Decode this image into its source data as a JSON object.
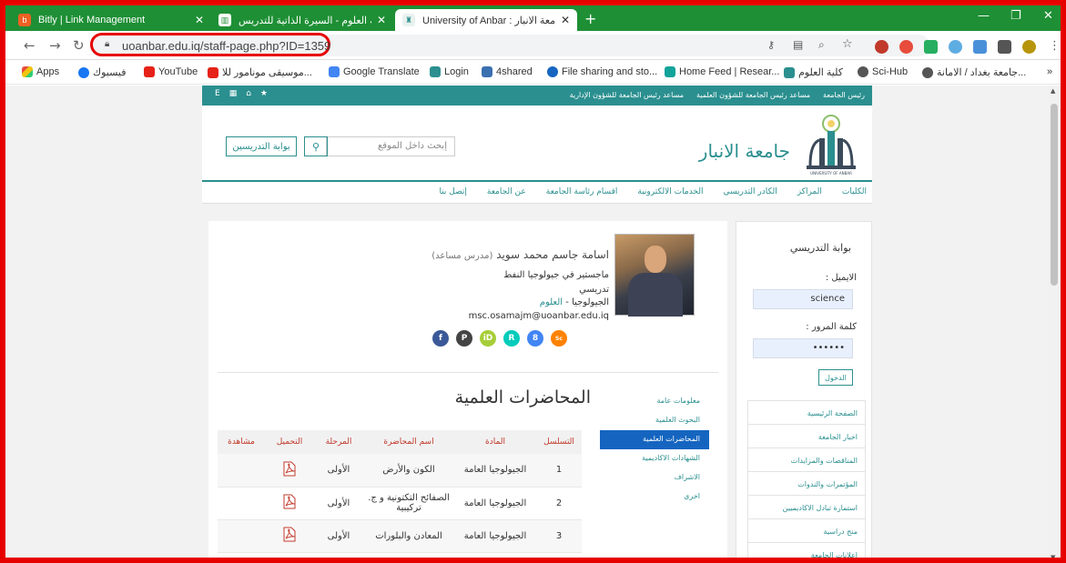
{
  "browser": {
    "tabs": [
      {
        "title": "Bitly | Link Management",
        "active": false
      },
      {
        "title": "كلية العلوم - السيرة الذاتية للتدريس...",
        "active": false
      },
      {
        "title": "University of Anbar : جامعة الانبار",
        "active": true
      }
    ],
    "new_tab": "+",
    "url": "uoanbar.edu.iq/staff-page.php?ID=1359",
    "bookmarks": [
      {
        "label": "Apps",
        "color": "#e74c3c"
      },
      {
        "label": "فيسبوك",
        "color": "#1877f2"
      },
      {
        "label": "YouTube",
        "color": "#e62117"
      },
      {
        "label": "موسيقى مونامور للا...",
        "color": "#e62117"
      },
      {
        "label": "Google Translate",
        "color": "#4285f4"
      },
      {
        "label": "Login",
        "color": "#2b8f8f"
      },
      {
        "label": "4shared",
        "color": "#3a6fb0"
      },
      {
        "label": "File sharing and sto...",
        "color": "#1565c0"
      },
      {
        "label": "Home Feed | Resear...",
        "color": "#12a39a"
      },
      {
        "label": "كلية العلوم",
        "color": "#2b8f8f"
      },
      {
        "label": "Sci-Hub",
        "color": "#555555"
      },
      {
        "label": "جامعة بغداد / الامانة...",
        "color": "#555555"
      }
    ],
    "bookmarks_more": "»"
  },
  "site": {
    "top_links": [
      "رئيس الجامعة",
      "مساعد رئيس الجامعة للشؤون العلمية",
      "مساعد رئيس الجامعة للشؤون الإدارية"
    ],
    "top_icons": [
      "E",
      "▦",
      "⌂",
      "★"
    ],
    "name": "جامعة الانبار",
    "logo_caption": "UNIVERSITY OF ANBAR",
    "search_placeholder": "إبحث داخل الموقع",
    "portal_button": "بوابة التدريسين",
    "nav": [
      "الكليات",
      "المراكز",
      "الكادر التدريسي",
      "الخدمات الالكترونية",
      "اقسام رئاسة الجامعة",
      "عن الجامعة",
      "إتصل بنا"
    ]
  },
  "profile": {
    "name": "اسامة جاسم محمد سويد",
    "rank": "(مدرس مساعد)",
    "degree": "ماجستير في جيولوجيا النفط",
    "position": "تدريسي",
    "department": "الجيولوجيا",
    "separator": " - ",
    "college": "العلوم",
    "email": "msc.osamajm@uoanbar.edu.iq",
    "socials": [
      {
        "name": "facebook",
        "glyph": "f",
        "color": "#3b5998"
      },
      {
        "name": "publons",
        "glyph": "P",
        "color": "#444444"
      },
      {
        "name": "orcid",
        "glyph": "iD",
        "color": "#a6ce39"
      },
      {
        "name": "researchgate",
        "glyph": "R",
        "color": "#00ccbb"
      },
      {
        "name": "google-scholar",
        "glyph": "8",
        "color": "#4285f4"
      },
      {
        "name": "scopus",
        "glyph": "Sc",
        "color": "#ff8200"
      }
    ]
  },
  "lectures": {
    "title": "المحاضرات العلمية",
    "side_menu": [
      {
        "label": "معلومات عامة",
        "active": false
      },
      {
        "label": "البحوث العلمية",
        "active": false
      },
      {
        "label": "المحاضرات العلمية",
        "active": true
      },
      {
        "label": "الشهادات الاكاديمية",
        "active": false
      },
      {
        "label": "الاشراف",
        "active": false
      },
      {
        "label": "اخرى",
        "active": false
      }
    ],
    "headers": [
      "التسلسل",
      "المادة",
      "اسم المحاضرة",
      "المرحلة",
      "التحميل",
      "مشاهدة"
    ],
    "rows": [
      {
        "seq": "1",
        "subject": "الجيولوجيا العامة",
        "lecture": "الكون والأرض",
        "stage": "الأولى"
      },
      {
        "seq": "2",
        "subject": "الجيولوجيا العامة",
        "lecture": "الصفائح التكتونية و ج. تركيبية",
        "stage": "الأولى"
      },
      {
        "seq": "3",
        "subject": "الجيولوجيا العامة",
        "lecture": "المعادن والبلورات",
        "stage": "الأولى"
      }
    ]
  },
  "login_panel": {
    "title": "بوابة التدريسي",
    "email_label": "الايميل :",
    "email_value": "science",
    "password_label": "كلمة المرور :",
    "password_value": "••••••",
    "login_button": "الدخول",
    "menu": [
      "الصفحة الرئيسية",
      "اخبار الجامعة",
      "المناقصات والمزايدات",
      "المؤتمرات والندوات",
      "استمارة تبادل الاكاديميين",
      "منح دراسية",
      "إعلانات الجامعة"
    ]
  }
}
